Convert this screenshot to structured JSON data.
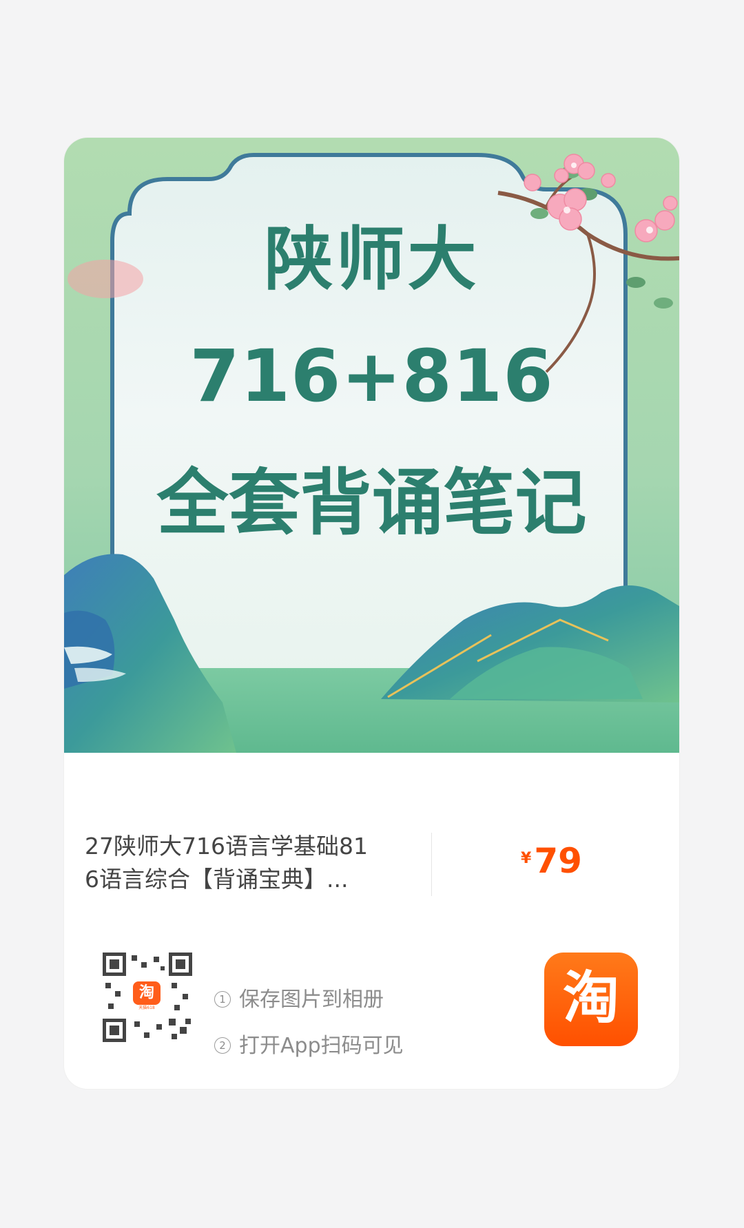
{
  "banner": {
    "line1": "陕师大",
    "line2": "716+816",
    "line3": "全套背诵笔记"
  },
  "product": {
    "title_line1": "27陕师大716语言学基础81",
    "title_line2": "6语言综合【背诵宝典】...",
    "currency": "¥",
    "price": "79"
  },
  "share": {
    "qr_icon": "qr-code-icon",
    "mini_logo": "淘",
    "mini_caption": "天猫618",
    "steps": [
      {
        "num": "1",
        "text": "保存图片到相册"
      },
      {
        "num": "2",
        "text": "打开App扫码可见"
      }
    ]
  },
  "app_icon": {
    "icon": "taobao-app-icon",
    "glyph": "淘"
  },
  "colors": {
    "brand_orange": "#ff5000",
    "banner_text": "#2c7f6e",
    "banner_bg": "#a9d6ae"
  }
}
